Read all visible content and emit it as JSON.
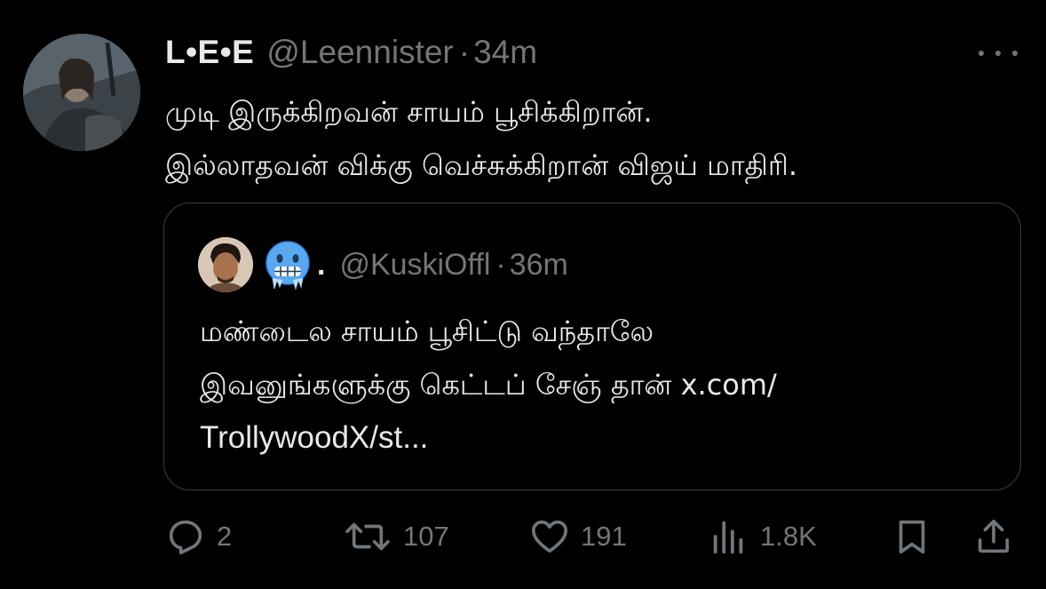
{
  "tweet": {
    "author": {
      "display_name": "L•E•E",
      "handle": "@Leennister",
      "separator": "·",
      "time": "34m"
    },
    "text_lines": [
      "முடி இருக்கிறவன் சாயம் பூசிக்கிறான்.",
      "இல்லாதவன் விக்கு வெச்சுக்கிறான் விஜய் மாதிரி."
    ],
    "more_icon": "more-horizontal-icon"
  },
  "quote": {
    "display_name": ".",
    "handle": "@KuskiOffl",
    "separator": "·",
    "time": "36m",
    "emoji": "cold-face-emoji",
    "text_lines": [
      "மண்டைல சாயம் பூசிட்டு வந்தாலே",
      "இவனுங்களுக்கு கெட்டப் சேஞ் தான் x.com/",
      "TrollywoodX/st..."
    ]
  },
  "actions": {
    "reply": {
      "icon": "reply-icon",
      "count": "2"
    },
    "retweet": {
      "icon": "retweet-icon",
      "count": "107"
    },
    "like": {
      "icon": "heart-icon",
      "count": "191"
    },
    "views": {
      "icon": "views-icon",
      "count": "1.8K"
    },
    "bookmark": {
      "icon": "bookmark-icon"
    },
    "share": {
      "icon": "share-icon"
    }
  },
  "colors": {
    "background": "#000000",
    "text_primary": "#e7e9ea",
    "text_secondary": "#71767b",
    "border": "#3a3f44"
  }
}
